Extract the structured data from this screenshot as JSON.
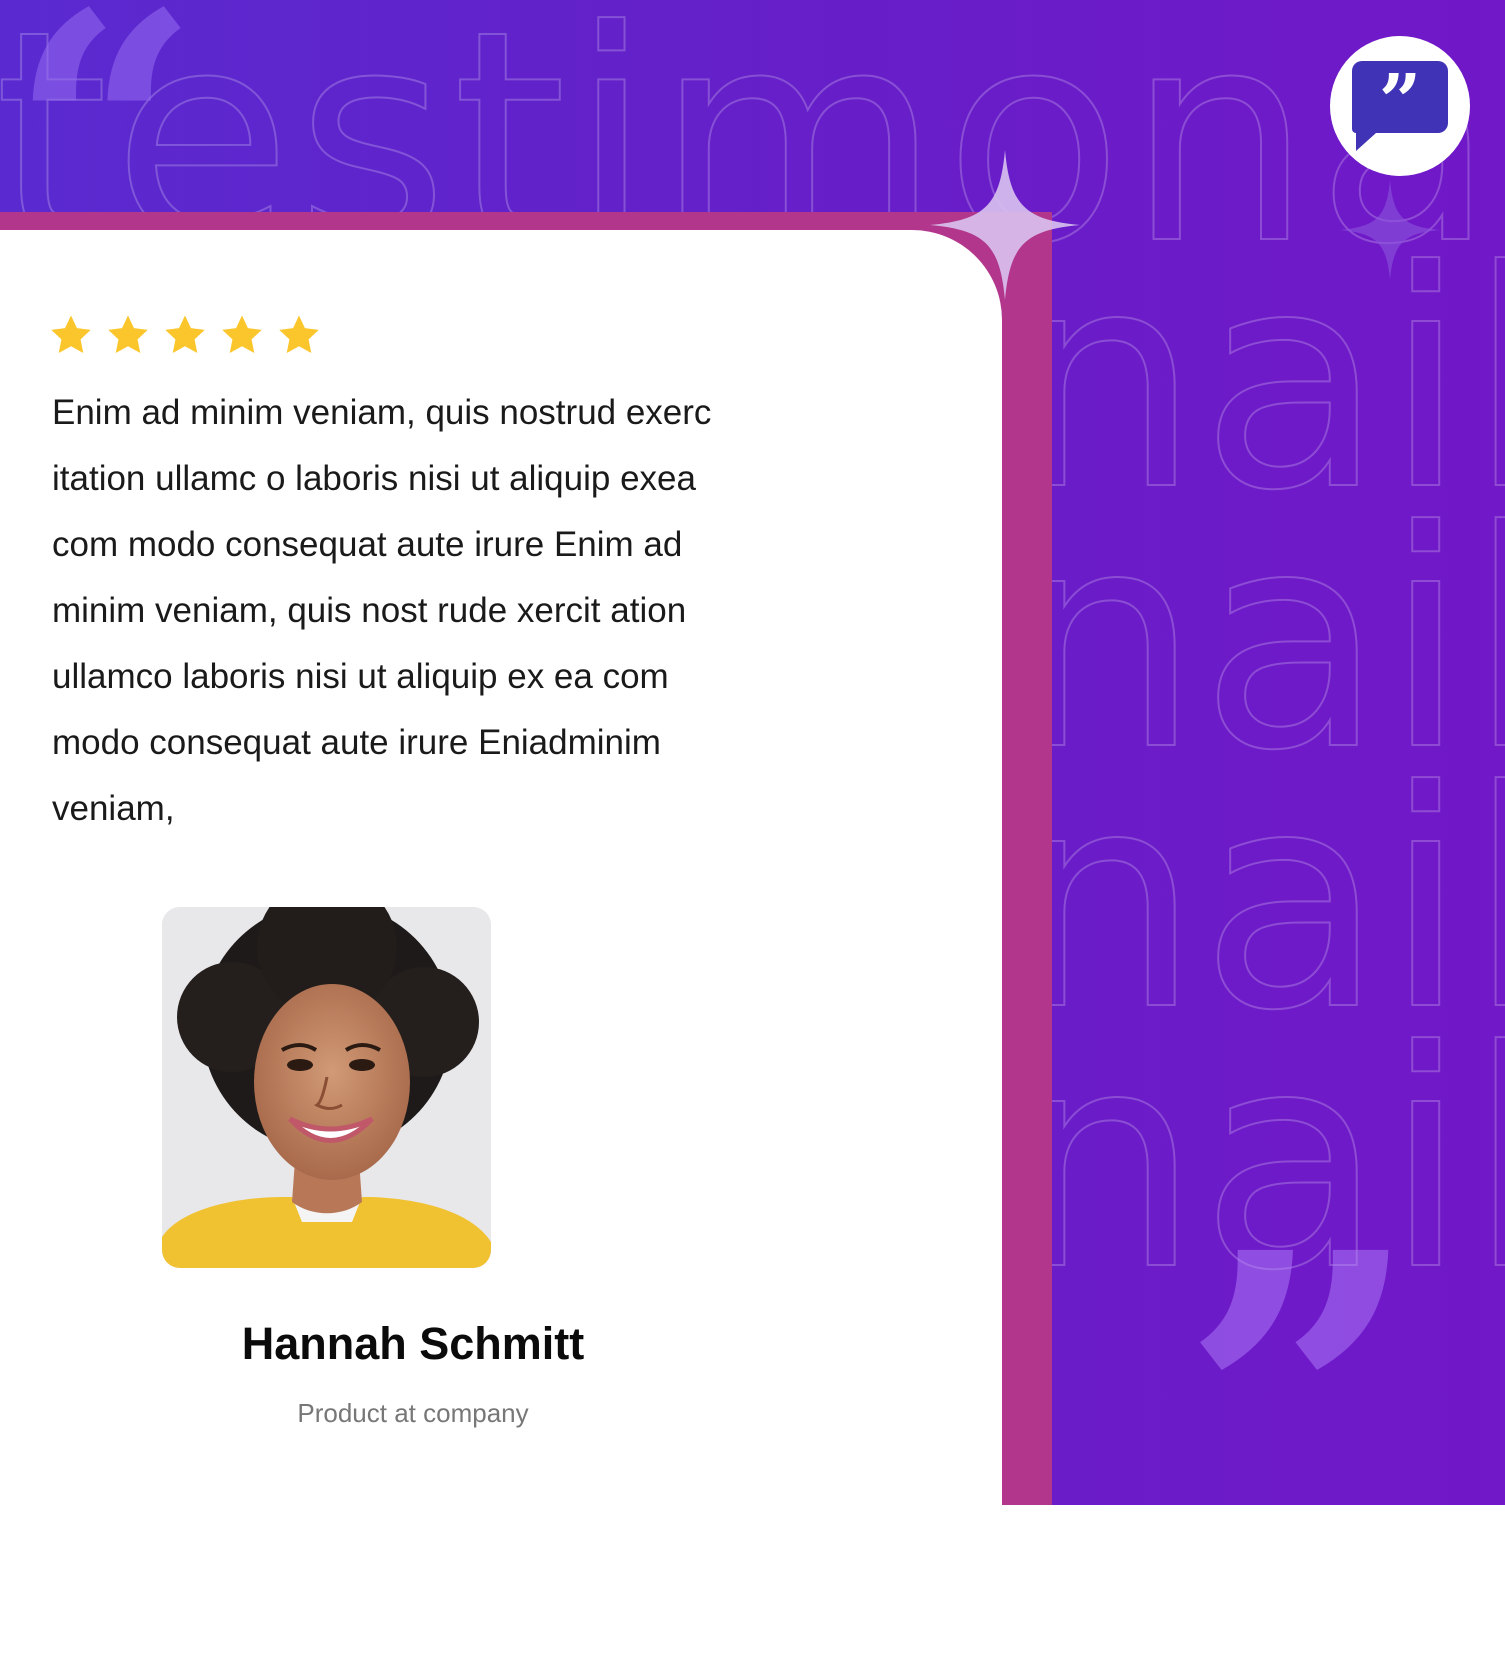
{
  "background": {
    "top_watermark": "testimonails",
    "side_watermark": "nails",
    "colors": {
      "primary": "#6420c9",
      "accent": "#b2368c",
      "star": "#fbc62c"
    }
  },
  "badge": {
    "icon": "quote-bubble-icon"
  },
  "rating": {
    "stars": 5,
    "max": 5
  },
  "review": {
    "lines": [
      "Enim ad minim veniam, quis nostrud exerc",
      "itation ullamc o laboris nisi ut aliquip exea",
      "com modo consequat aute irure Enim ad",
      "minim veniam, quis nost rude xercit ation",
      "ullamco laboris nisi ut aliquip ex ea com",
      "modo consequat aute irure Eniadminim",
      "veniam,"
    ]
  },
  "author": {
    "name": "Hannah Schmitt",
    "role": "Product at company",
    "avatar": "portrait-photo"
  }
}
